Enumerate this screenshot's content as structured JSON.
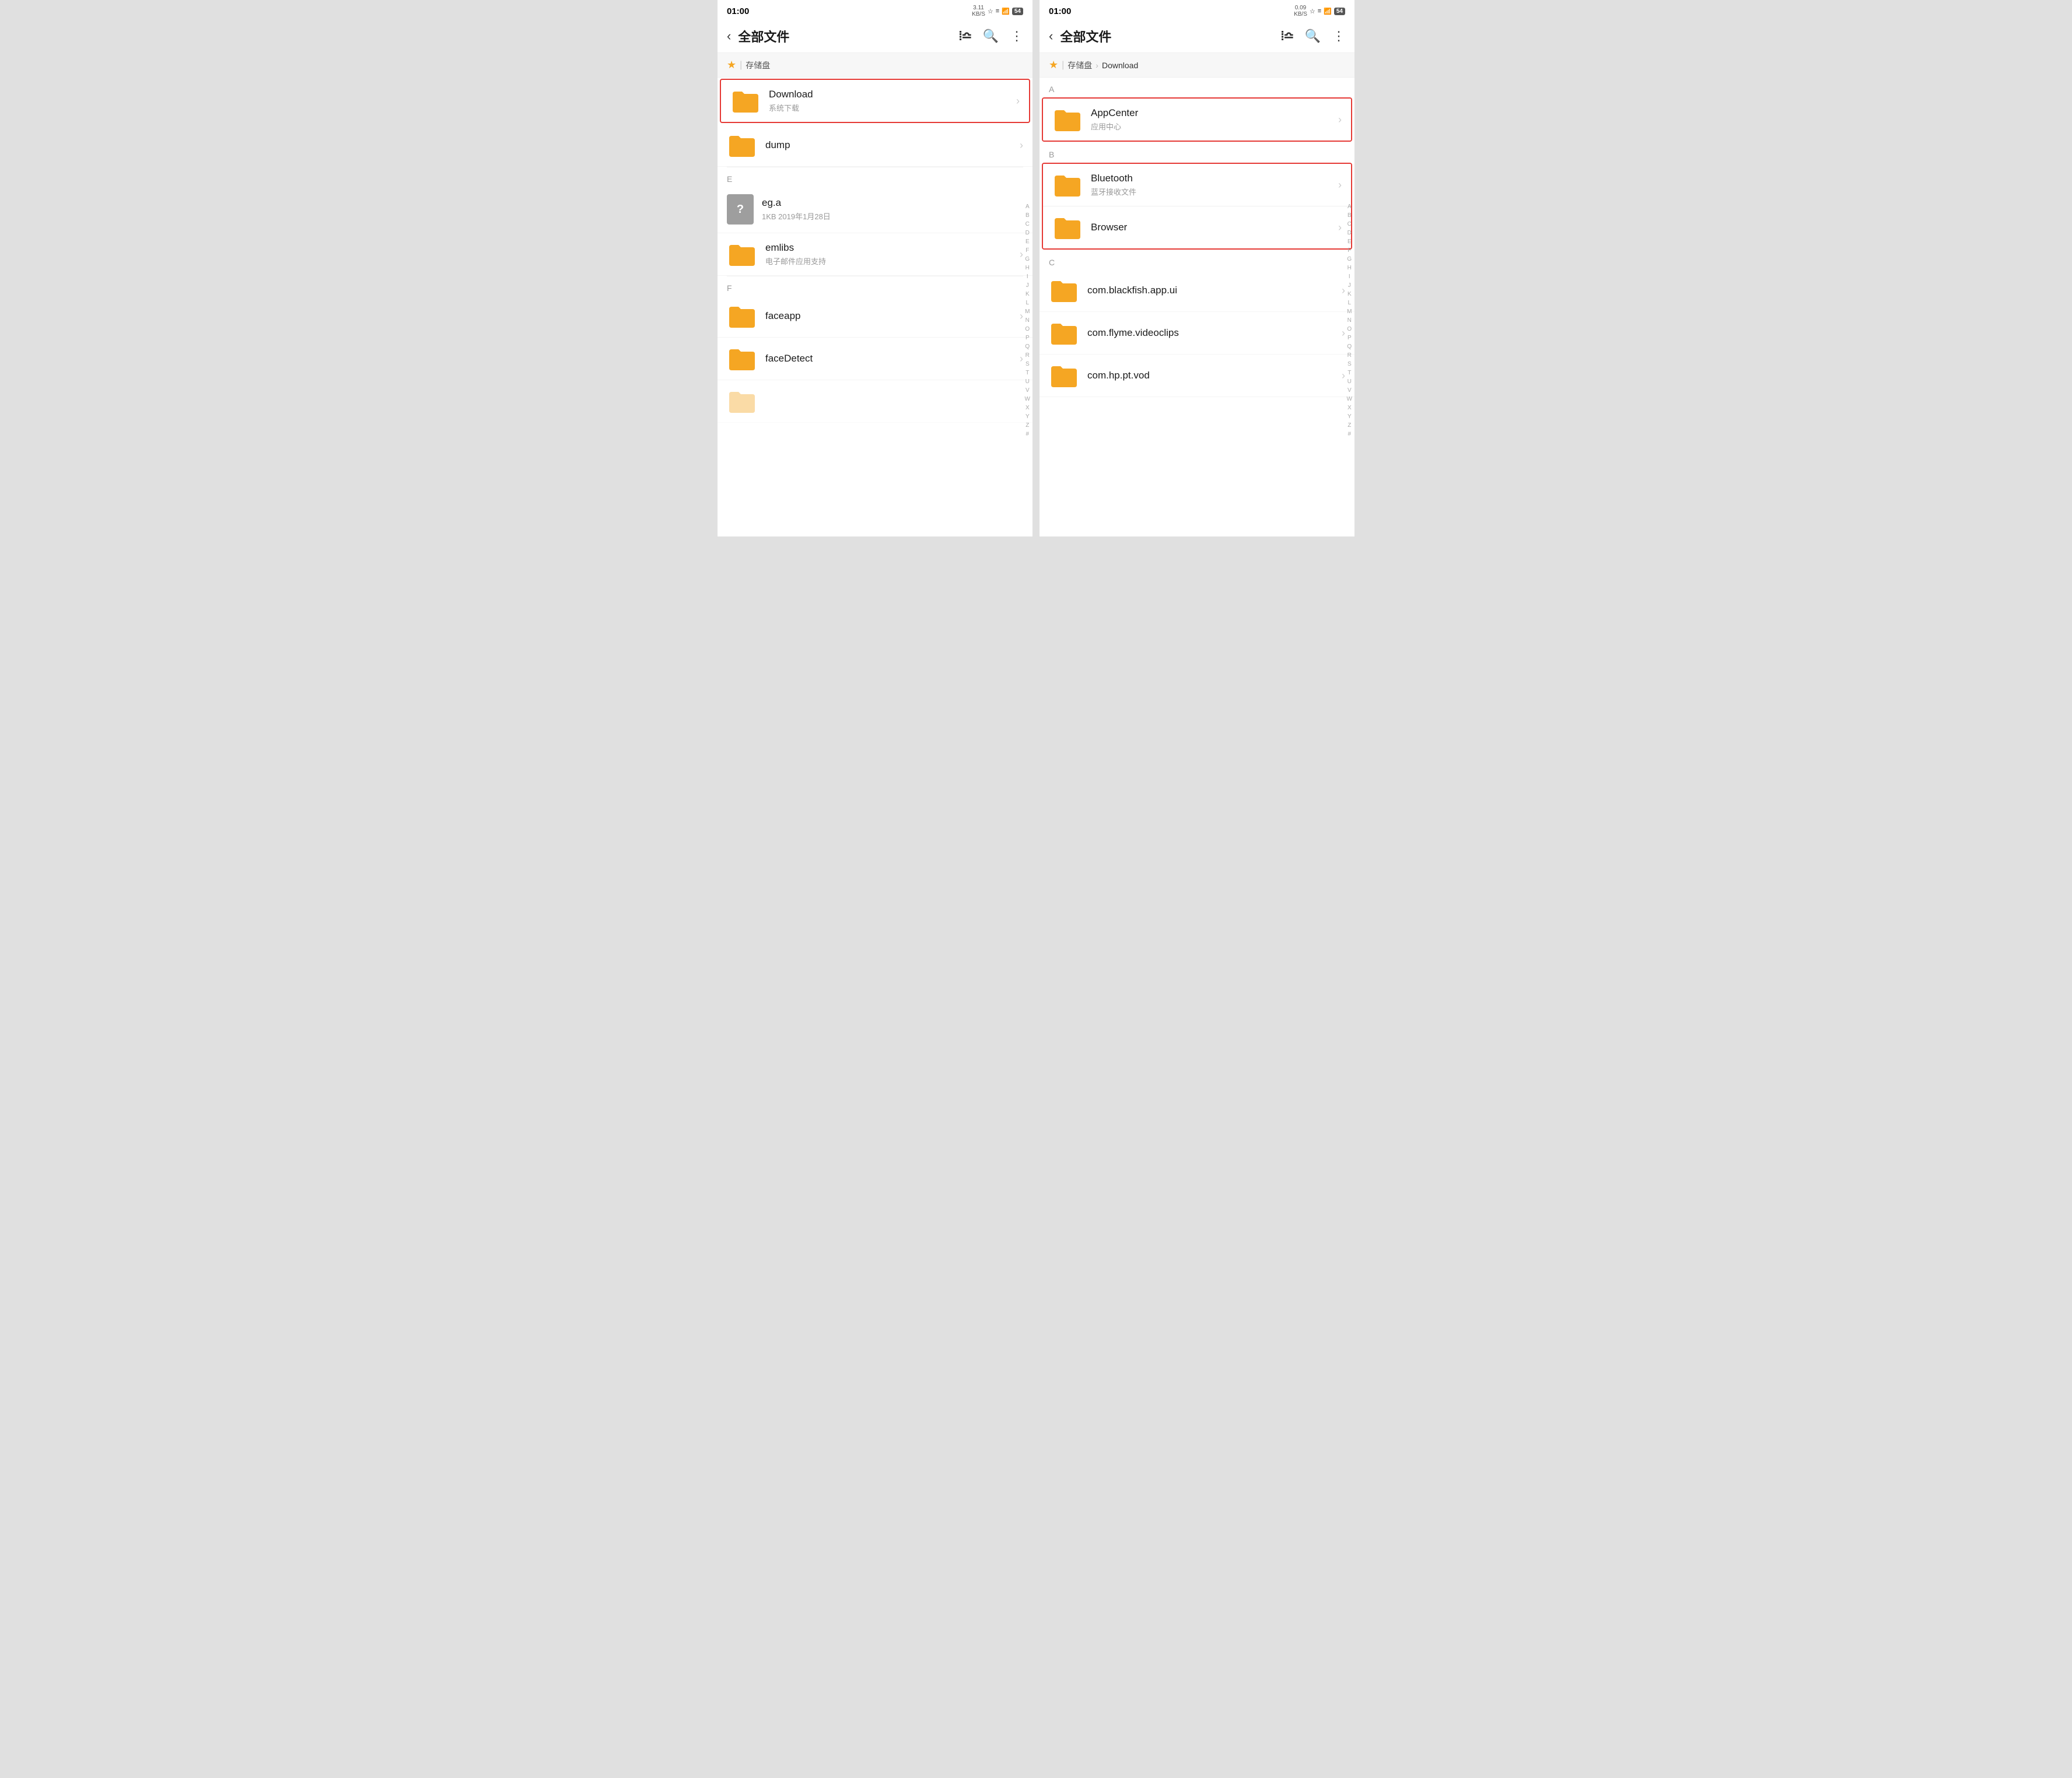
{
  "left_panel": {
    "status": {
      "time": "01:00",
      "network_speed": "3.11\nKB/S",
      "battery": "54"
    },
    "app_bar": {
      "back_label": "＜",
      "title": "全部文件",
      "sort_icon": "sort",
      "search_icon": "search",
      "more_icon": "more"
    },
    "breadcrumb": {
      "star": "★",
      "sep": "|",
      "storage": "存储盘"
    },
    "sections": {
      "highlighted_folder": {
        "name": "Download",
        "meta": "系统下载"
      },
      "ungrouped": [
        {
          "name": "dump",
          "meta": "",
          "type": "folder"
        }
      ],
      "section_e": {
        "header": "E",
        "items": [
          {
            "name": "eg.a",
            "meta": "1KB  2019年1月28日",
            "type": "unknown"
          },
          {
            "name": "emlibs",
            "meta": "电子邮件应用支持",
            "type": "folder"
          }
        ]
      },
      "section_f": {
        "header": "F",
        "items": [
          {
            "name": "faceapp",
            "meta": "",
            "type": "folder"
          },
          {
            "name": "faceDetect",
            "meta": "",
            "type": "folder"
          }
        ]
      }
    },
    "alphabet": [
      "A",
      "B",
      "C",
      "D",
      "E",
      "F",
      "G",
      "H",
      "I",
      "J",
      "K",
      "L",
      "M",
      "N",
      "O",
      "P",
      "Q",
      "R",
      "S",
      "T",
      "U",
      "V",
      "W",
      "X",
      "Y",
      "Z",
      "#"
    ]
  },
  "right_panel": {
    "status": {
      "time": "01:00",
      "network_speed": "0.09\nKB/S",
      "battery": "54"
    },
    "app_bar": {
      "back_label": "＜",
      "title": "全部文件",
      "sort_icon": "sort",
      "search_icon": "search",
      "more_icon": "more"
    },
    "breadcrumb": {
      "star": "★",
      "sep": "|",
      "storage": "存储盘",
      "arrow": "›",
      "current": "Download"
    },
    "sections": {
      "section_a": {
        "header": "A",
        "highlighted_items": [
          {
            "name": "AppCenter",
            "meta": "应用中心",
            "type": "folder"
          }
        ]
      },
      "section_b": {
        "header": "B",
        "highlighted_items": [
          {
            "name": "Bluetooth",
            "meta": "蓝牙接收文件",
            "type": "folder"
          },
          {
            "name": "Browser",
            "meta": "",
            "type": "folder"
          }
        ]
      },
      "section_c": {
        "header": "C",
        "items": [
          {
            "name": "com.blackfish.app.ui",
            "meta": "",
            "type": "folder"
          },
          {
            "name": "com.flyme.videoclips",
            "meta": "",
            "type": "folder"
          },
          {
            "name": "com.hp.pt.vod",
            "meta": "",
            "type": "folder"
          }
        ]
      }
    },
    "alphabet": [
      "A",
      "B",
      "C",
      "D",
      "E",
      "F",
      "G",
      "H",
      "I",
      "J",
      "K",
      "L",
      "M",
      "N",
      "O",
      "P",
      "Q",
      "R",
      "S",
      "T",
      "U",
      "V",
      "W",
      "X",
      "Y",
      "Z",
      "#"
    ]
  },
  "colors": {
    "folder": "#F5A623",
    "highlight_border": "#e53935",
    "text_primary": "#1a1a1a",
    "text_secondary": "#999999",
    "background": "#ffffff",
    "section_bg": "#f7f7f7"
  },
  "icons": {
    "sort": "IE",
    "search": "Q",
    "more": "⋮",
    "back": "<",
    "chevron_right": "›",
    "star": "★",
    "question": "?"
  }
}
